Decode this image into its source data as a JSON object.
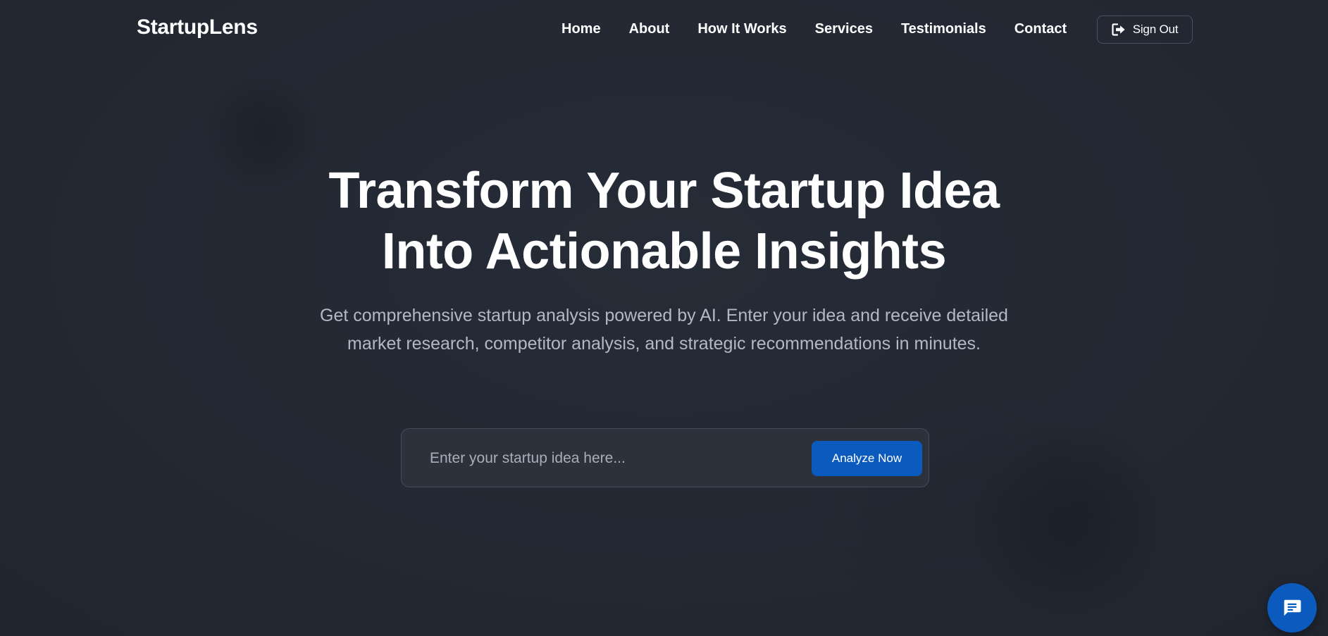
{
  "brand": {
    "name": "StartupLens"
  },
  "nav": {
    "items": [
      {
        "label": "Home"
      },
      {
        "label": "About"
      },
      {
        "label": "How It Works"
      },
      {
        "label": "Services"
      },
      {
        "label": "Testimonials"
      },
      {
        "label": "Contact"
      }
    ],
    "signout": {
      "label": "Sign Out",
      "icon": "sign-out-icon"
    }
  },
  "hero": {
    "title_line1": "Transform Your Startup Idea",
    "title_line2": "Into Actionable Insights",
    "subtitle": "Get comprehensive startup analysis powered by AI. Enter your idea and receive detailed market research, competitor analysis, and strategic recommendations in minutes."
  },
  "search": {
    "placeholder": "Enter your startup idea here...",
    "value": "",
    "button_label": "Analyze Now"
  },
  "chat": {
    "icon": "chat-icon"
  },
  "colors": {
    "background": "#242933",
    "accent": "#0a5bbd",
    "text": "#ffffff",
    "muted_text": "#b2b8c4",
    "input_bg": "#2c313c"
  }
}
